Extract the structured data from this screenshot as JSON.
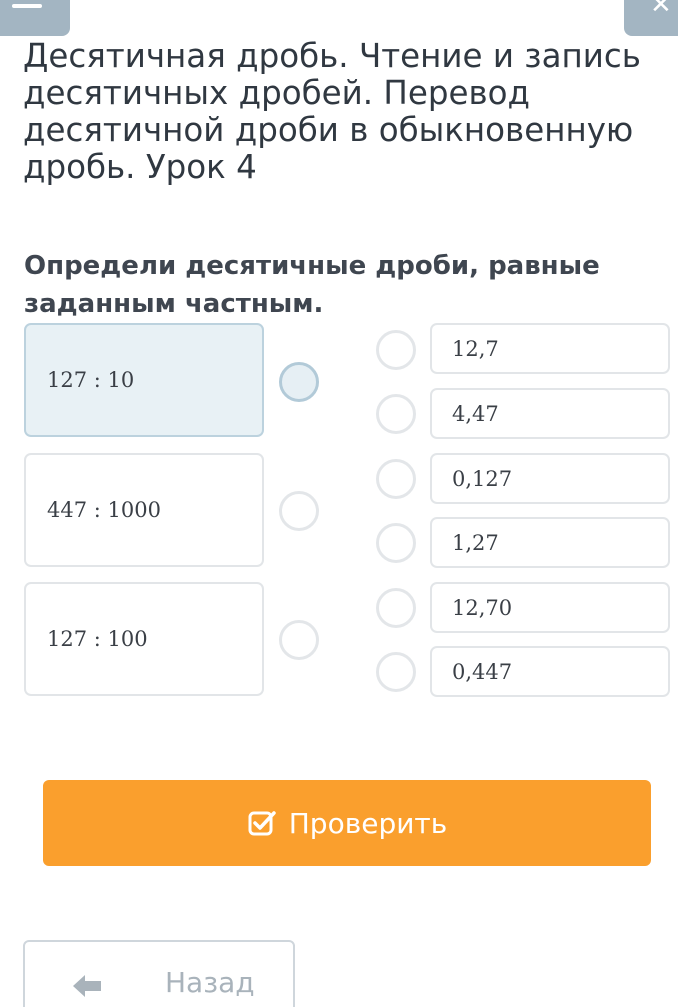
{
  "window": {
    "minimize_icon": "minus-icon",
    "close_icon": "close-icon"
  },
  "lesson": {
    "title": "Десятичная дробь. Чтение и запись десятичных дробей. Перевод десятичной дроби в обыкновенную дробь. Урок 4"
  },
  "task": {
    "prompt": "Определи десятичные дроби, равные заданным частным.",
    "quotients": [
      {
        "label": "127 : 10",
        "selected": true
      },
      {
        "label": "447 : 1000",
        "selected": false
      },
      {
        "label": "127 : 100",
        "selected": false
      }
    ],
    "answers": [
      {
        "label": "12,7"
      },
      {
        "label": "4,47"
      },
      {
        "label": "0,127"
      },
      {
        "label": "1,27"
      },
      {
        "label": "12,70"
      },
      {
        "label": "0,447"
      }
    ]
  },
  "actions": {
    "check_label": "Проверить",
    "check_icon": "checkbox-check-icon",
    "back_label": "Назад",
    "back_icon": "arrow-left-icon"
  },
  "colors": {
    "accent_orange": "#fa9f2d",
    "selected_background": "#e8f1f5",
    "corner_button": "#a3b5c2"
  }
}
